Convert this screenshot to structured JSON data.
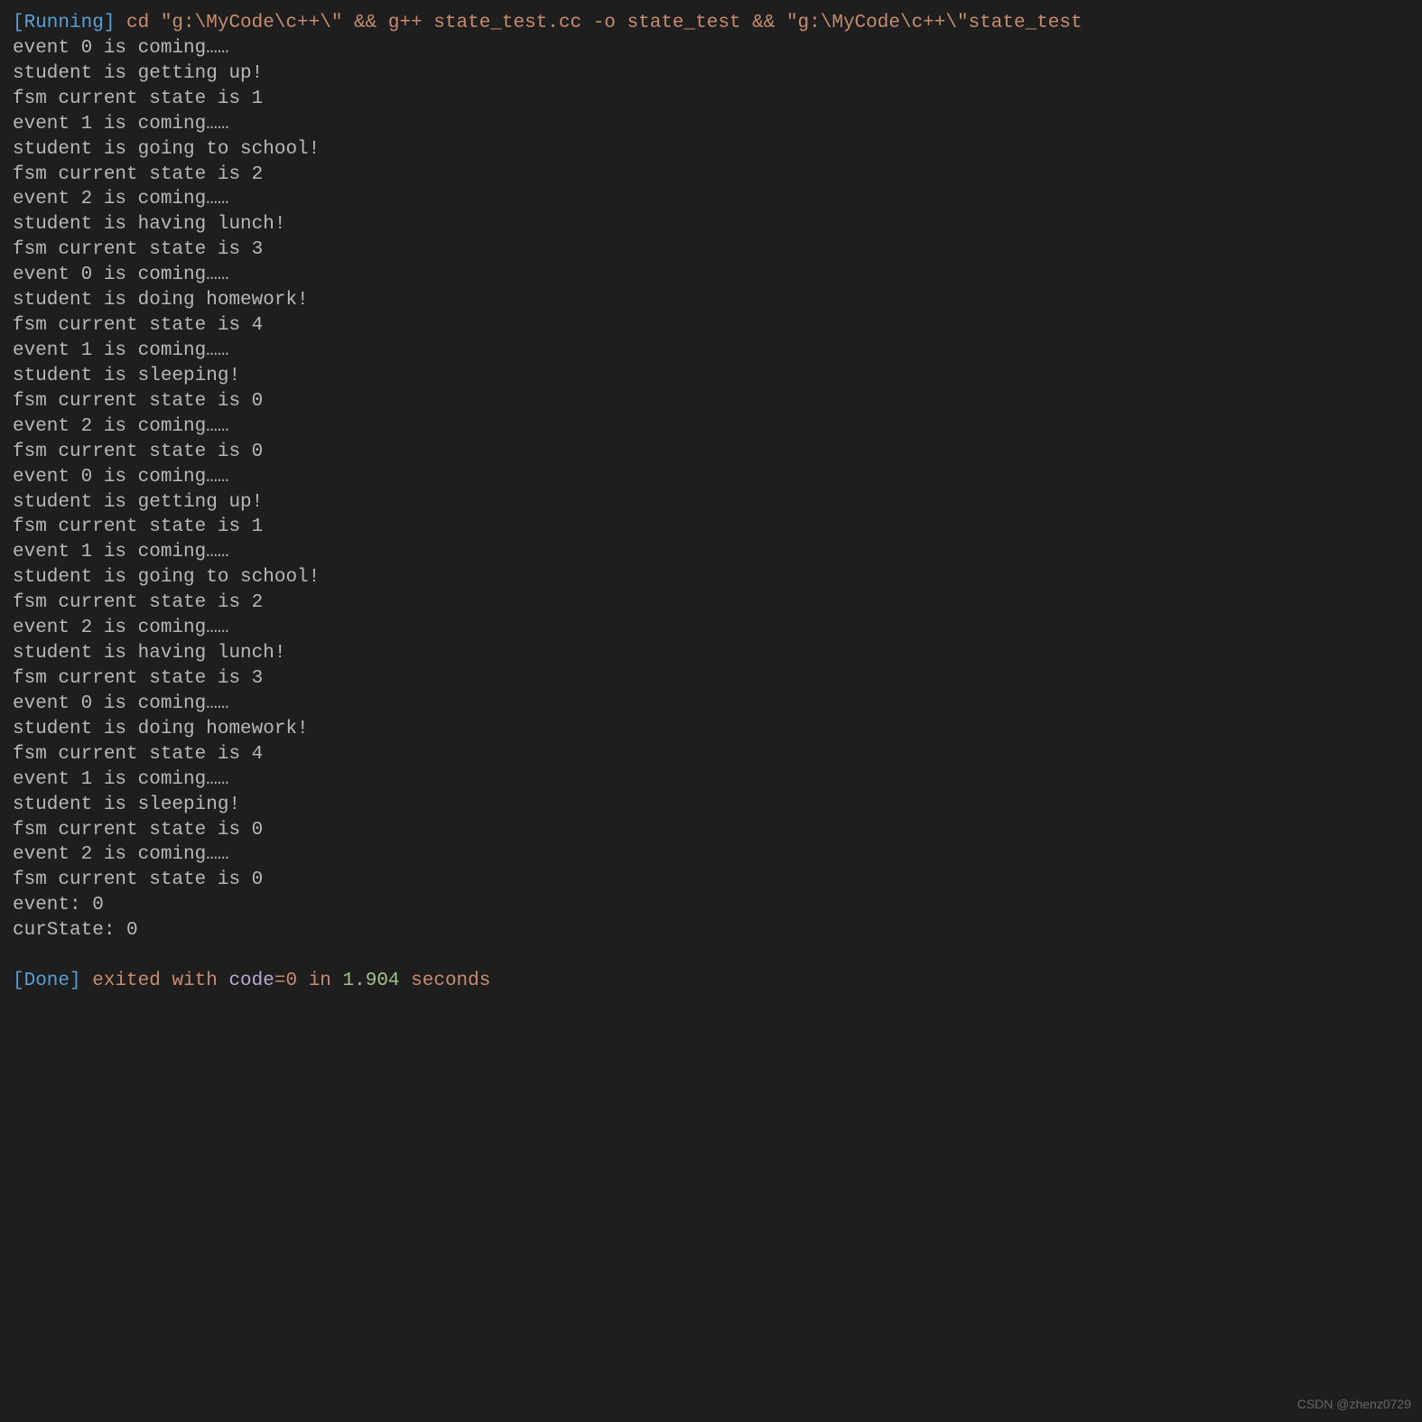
{
  "running_status": "[Running]",
  "running_command": " cd \"g:\\MyCode\\c++\\\" && g++ state_test.cc -o state_test && \"g:\\MyCode\\c++\\\"state_test",
  "output_lines": [
    "event 0 is coming……",
    "student is getting up!",
    "fsm current state is 1",
    "event 1 is coming……",
    "student is going to school!",
    "fsm current state is 2",
    "event 2 is coming……",
    "student is having lunch!",
    "fsm current state is 3",
    "event 0 is coming……",
    "student is doing homework!",
    "fsm current state is 4",
    "event 1 is coming……",
    "student is sleeping!",
    "fsm current state is 0",
    "event 2 is coming……",
    "fsm current state is 0",
    "event 0 is coming……",
    "student is getting up!",
    "fsm current state is 1",
    "event 1 is coming……",
    "student is going to school!",
    "fsm current state is 2",
    "event 2 is coming……",
    "student is having lunch!",
    "fsm current state is 3",
    "event 0 is coming……",
    "student is doing homework!",
    "fsm current state is 4",
    "event 1 is coming……",
    "student is sleeping!",
    "fsm current state is 0",
    "event 2 is coming……",
    "fsm current state is 0",
    "event: 0",
    "curState: 0"
  ],
  "done_status": "[Done]",
  "done_exit": " exited with ",
  "done_code_name": "code",
  "done_code_equals": "=",
  "done_code_value": "0",
  "done_in": " in ",
  "done_time": "1.904",
  "done_seconds": " seconds",
  "watermark": "CSDN @zhenz0729"
}
